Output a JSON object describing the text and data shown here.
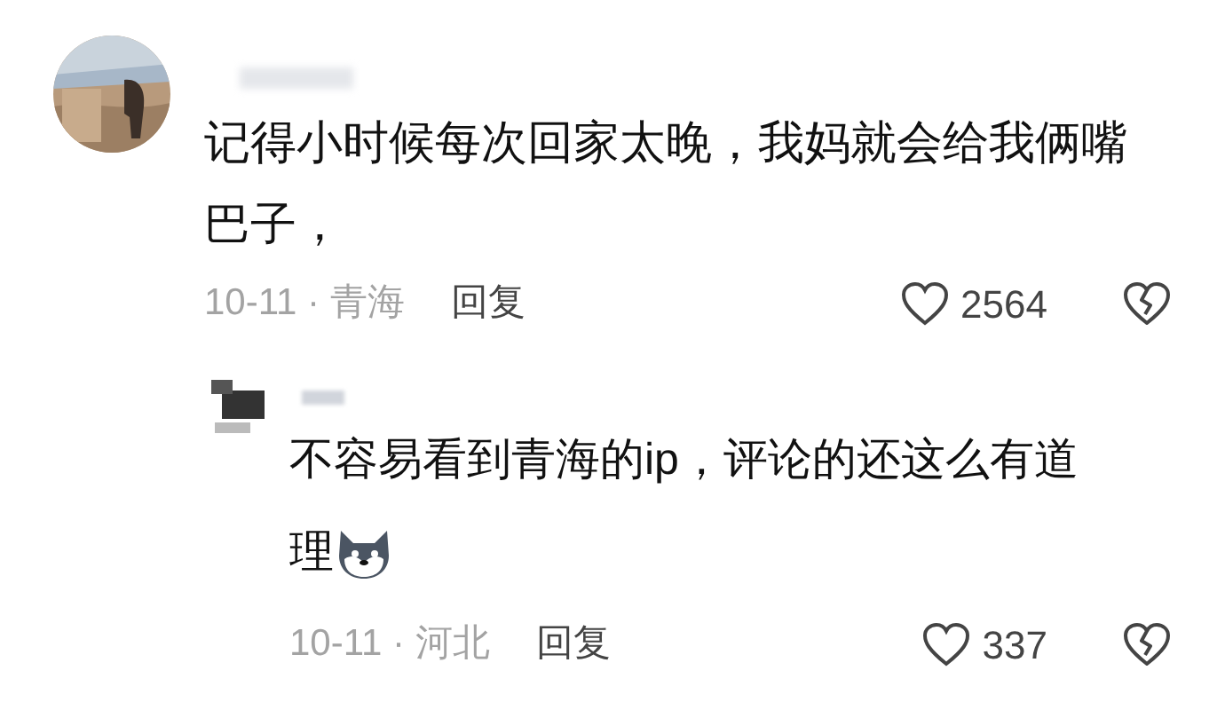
{
  "comments": [
    {
      "kind": "comment",
      "text": "记得小时候每次回家太晚，我妈就会给我俩嘴巴子，",
      "meta": "10-11 · 青海",
      "reply_label": "回复",
      "likes": "2564",
      "sticker": false
    },
    {
      "kind": "reply",
      "text": "不容易看到青海的ip，评论的还这么有道理",
      "meta": "10-11 · 河北",
      "reply_label": "回复",
      "likes": "337",
      "sticker": true
    }
  ]
}
